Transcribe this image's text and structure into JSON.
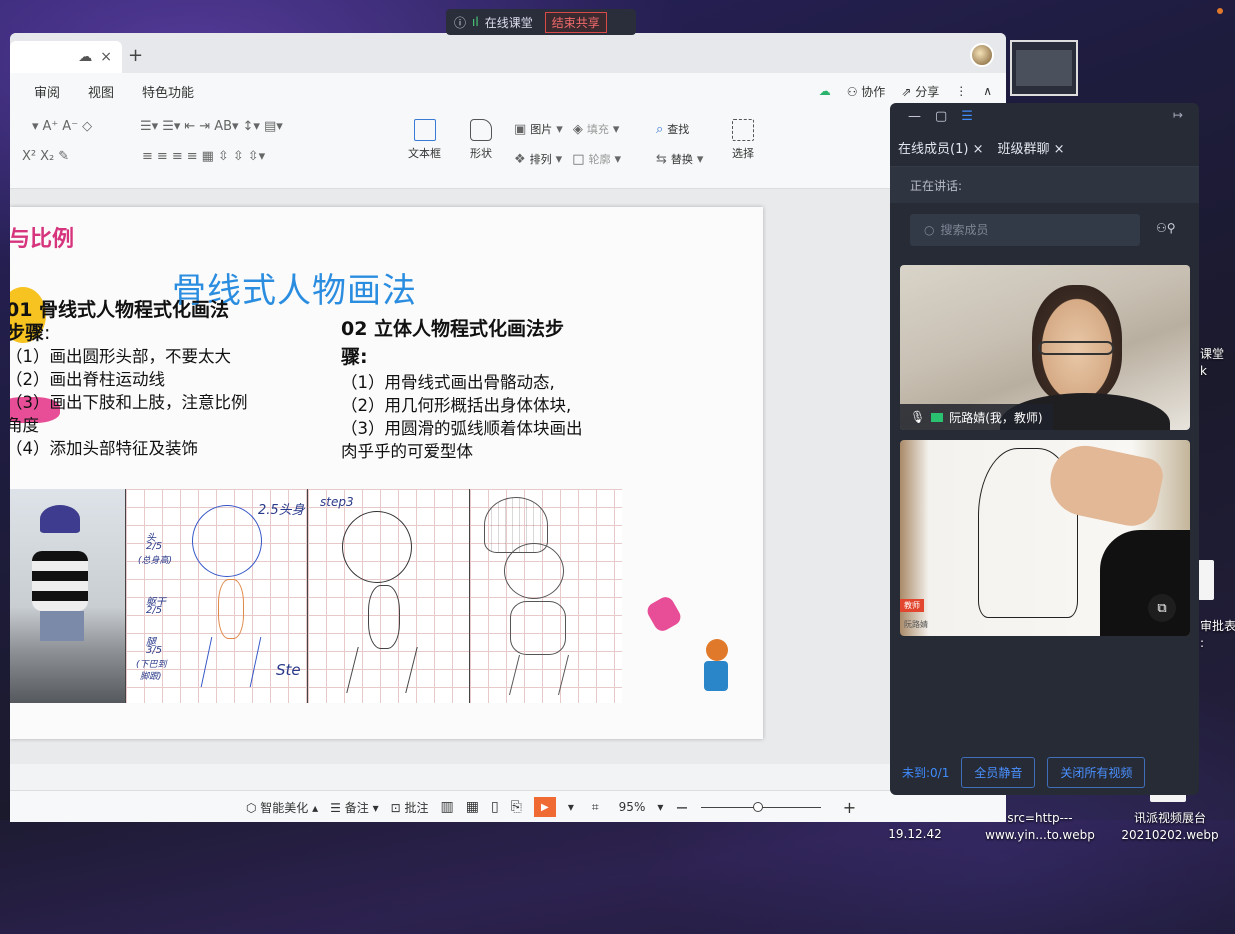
{
  "share_bar": {
    "title": "在线课堂",
    "end_label": "结束共享"
  },
  "wps": {
    "tab_close": "×",
    "tab_add": "+",
    "menu": [
      "审阅",
      "视图",
      "特色功能"
    ],
    "menu_right": {
      "collab": "协作",
      "share": "分享"
    },
    "ribbon": {
      "textbox": "文本框",
      "shape": "形状",
      "picture": "图片",
      "fill": "填充",
      "arrange": "排列",
      "outline": "轮廓",
      "find": "查找",
      "replace": "替换",
      "select": "选择"
    },
    "slide": {
      "corner_title": "与比例",
      "main_title": "骨线式人物画法",
      "col1": {
        "heading": "01 骨线式人物程式化画法",
        "heading2": "步骤",
        "steps": [
          "（1）画出圆形头部，不要太大",
          "（2）画出脊柱运动线",
          "（3）画出下肢和上肢，注意比例",
          "角度",
          "（4）添加头部特征及装饰"
        ]
      },
      "col2": {
        "heading": "02 立体人物程式化画法步",
        "heading2": "骤:",
        "steps": [
          "（1）用骨线式画出骨骼动态,",
          "（2）用几何形概括出身体体块,",
          "（3）用圆滑的弧线顺着体块画出",
          "肉乎乎的可爱型体"
        ]
      },
      "pic_labels": {
        "grid1_head": "2.5头身",
        "grid1_a": "头",
        "grid1_a2": "2/5",
        "grid1_a3": "(总身高)",
        "grid1_b": "躯干",
        "grid1_b2": "2/5",
        "grid1_c": "腿",
        "grid1_c2": "3/5",
        "grid1_c3": "(下巴到",
        "grid1_c4": "脚跟)",
        "grid1_step": "Ste",
        "grid2_step": "step3"
      }
    },
    "status": {
      "beautify": "智能美化",
      "notes": "备注",
      "comment": "批注",
      "zoom": "95%",
      "minus": "−",
      "plus": "+"
    }
  },
  "panel": {
    "tab_members": "在线成员(1)",
    "tab_chat": "班级群聊",
    "speaking": "正在讲话:",
    "search_placeholder": "搜索成员",
    "teacher_name": "阮路婧(我，教师)",
    "thumb_badge": "教师",
    "thumb_name": "阮路婧",
    "absent": "未到:0/1",
    "mute_all": "全员静音",
    "close_videos": "关闭所有视频"
  },
  "desktop": {
    "label_top_right_1": "课堂",
    "label_top_right_2": "k",
    "label_mid_right": "审批表",
    "label_mid_right_2": ":",
    "file1_line1": "19.12.42",
    "file2_line1": "src=http---",
    "file2_line2": "www.yin...to.webp",
    "file3_line1": "讯派视频展台",
    "file3_line2": "20210202.webp"
  }
}
